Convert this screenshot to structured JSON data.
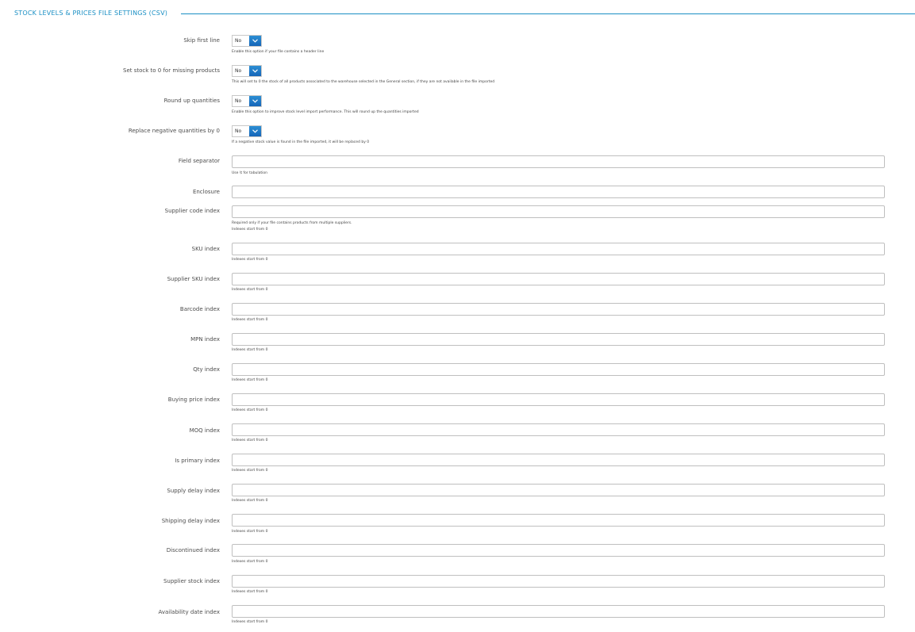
{
  "section": {
    "title": "STOCK LEVELS & PRICES FILE SETTINGS (CSV)"
  },
  "toggles": [
    {
      "label": "Skip first line",
      "value": "No",
      "help": "Enable this option if your file contains a header line"
    },
    {
      "label": "Set stock to 0 for missing products",
      "value": "No",
      "help": "This will set to 0 the stock of all products associated to the warehouse selected in the General section, if they are not available in the file imported"
    },
    {
      "label": "Round up quantities",
      "value": "No",
      "help": "Enable this option to improve stock level import performance. This will round up the quantities imported"
    },
    {
      "label": "Replace negative quantities by 0",
      "value": "No",
      "help": "If a negative stock value is found in the file imported, it will be replaced by 0"
    }
  ],
  "fields": [
    {
      "label": "Field separator",
      "value": "",
      "help": "Use \\t for tabulation",
      "help2": ""
    },
    {
      "label": "Enclosure",
      "value": "",
      "help": "",
      "help2": ""
    },
    {
      "label": "Supplier code index",
      "value": "",
      "help": "Required only if your file contains products from multiple suppliers.",
      "help2": "Indexes start from 0"
    },
    {
      "label": "SKU index",
      "value": "",
      "help": "Indexes start from 0",
      "help2": ""
    },
    {
      "label": "Supplier SKU index",
      "value": "",
      "help": "Indexes start from 0",
      "help2": ""
    },
    {
      "label": "Barcode index",
      "value": "",
      "help": "Indexes start from 0",
      "help2": ""
    },
    {
      "label": "MPN index",
      "value": "",
      "help": "Indexes start from 0",
      "help2": ""
    },
    {
      "label": "Qty index",
      "value": "",
      "help": "Indexes start from 0",
      "help2": ""
    },
    {
      "label": "Buying price index",
      "value": "",
      "help": "Indexes start from 0",
      "help2": ""
    },
    {
      "label": "MOQ index",
      "value": "",
      "help": "Indexes start from 0",
      "help2": ""
    },
    {
      "label": "Is primary index",
      "value": "",
      "help": "Indexes start from 0",
      "help2": ""
    },
    {
      "label": "Supply delay index",
      "value": "",
      "help": "Indexes start from 0",
      "help2": ""
    },
    {
      "label": "Shipping delay index",
      "value": "",
      "help": "Indexes start from 0",
      "help2": ""
    },
    {
      "label": "Discontinued index",
      "value": "",
      "help": "Indexes start from 0",
      "help2": ""
    },
    {
      "label": "Supplier stock index",
      "value": "",
      "help": "Indexes start from 0",
      "help2": ""
    },
    {
      "label": "Availability date index",
      "value": "",
      "help": "Indexes start from 0",
      "help2": ""
    }
  ],
  "colors": {
    "accent": "#1a8fc4",
    "toggle_button": "#1565b8",
    "input_border": "#bfbfbf"
  },
  "icons": {
    "toggle_button": "chevron-down-icon"
  }
}
